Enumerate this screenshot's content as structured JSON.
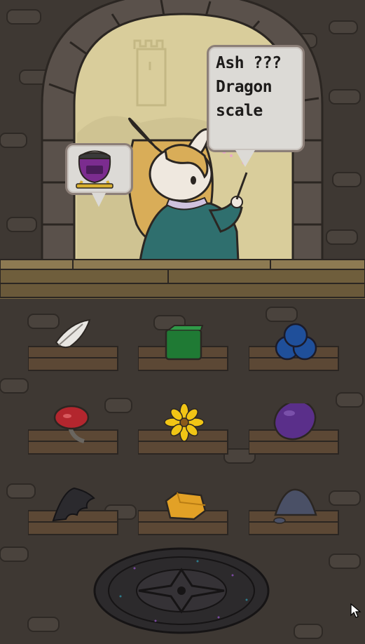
{
  "speech": {
    "recipe_text": "Ash ???\nDragon\nscale",
    "thought_icon": "cauldron-icon"
  },
  "ingredients": [
    {
      "name": "feather",
      "icon": "feather-icon"
    },
    {
      "name": "green cube",
      "icon": "green-cube-icon"
    },
    {
      "name": "blueberries",
      "icon": "blueberries-icon"
    },
    {
      "name": "red mushroom",
      "icon": "red-mushroom-icon"
    },
    {
      "name": "yellow flower",
      "icon": "yellow-flower-icon"
    },
    {
      "name": "purple egg",
      "icon": "purple-egg-icon"
    },
    {
      "name": "bat wing",
      "icon": "bat-wing-icon"
    },
    {
      "name": "gold nugget",
      "icon": "gold-nugget-icon"
    },
    {
      "name": "ash pile",
      "icon": "ash-pile-icon"
    }
  ],
  "colors": {
    "wall": "#3e3833",
    "stone": "#5a514b",
    "sky": "#d9cd9b",
    "counter": "#7c6a45",
    "shelf": "#5c4835",
    "robe": "#2f6f6e",
    "hair": "#d9ad58"
  },
  "magic_circle_icon": "summoning-circle-icon"
}
